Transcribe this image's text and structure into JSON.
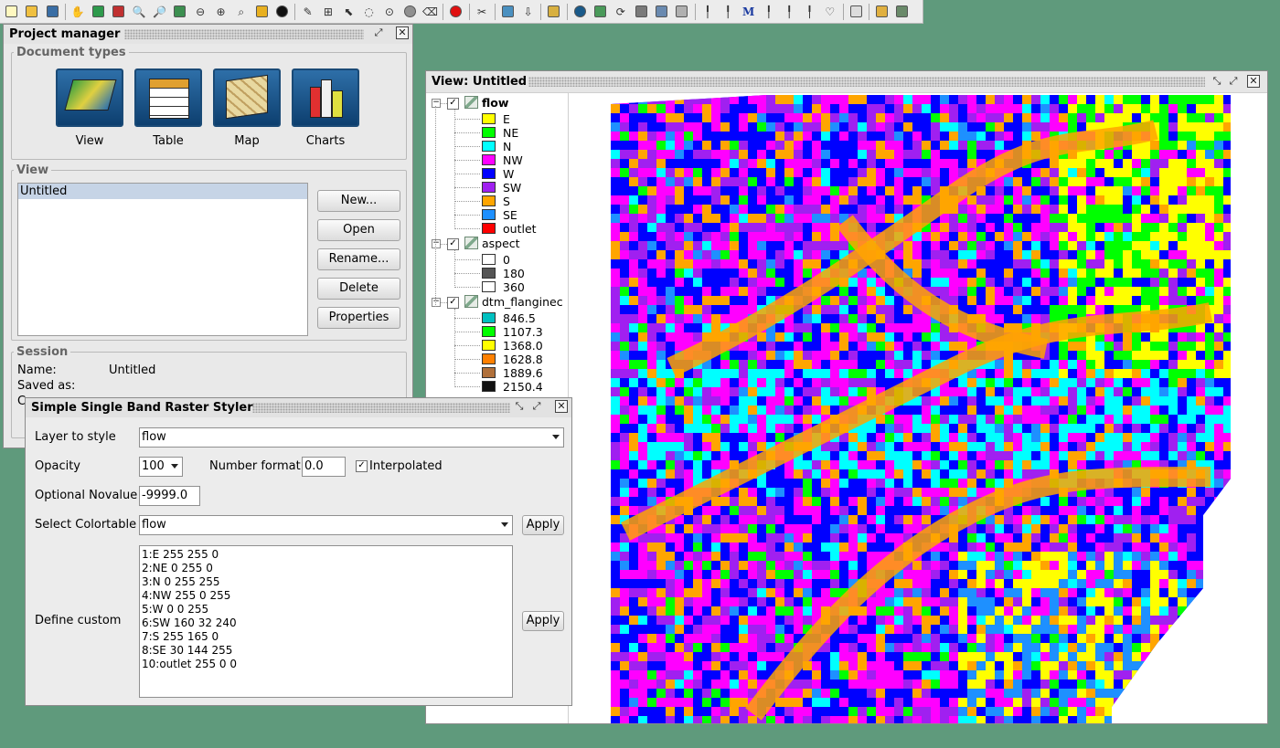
{
  "toolbar": {
    "icons": [
      "new-icon",
      "open-icon",
      "save-icon",
      "pan-icon",
      "zoom-extent-icon",
      "zoom-layer-icon",
      "zoom-in-icon",
      "zoom-out-icon",
      "layers-icon",
      "zoom-previous-icon",
      "zoom-next-icon",
      "zoom-select-icon",
      "select-color-icon",
      "info-icon",
      "measure-icon",
      "select-icon",
      "pointer-icon",
      "circle-select-icon",
      "lasso-icon",
      "sphere-icon",
      "erase-icon",
      "stop-icon",
      "tools-icon",
      "import-icon",
      "export-icon",
      "tape-icon",
      "globe-icon",
      "map-icon",
      "cycle-icon",
      "database-icon",
      "tools2-icon",
      "picture-icon",
      "pin-icon",
      "pin2-icon",
      "formula-icon",
      "pin3-icon",
      "pin4-icon",
      "pin5-icon",
      "balloon-icon",
      "notes-icon",
      "folder-icon",
      "gallery-icon"
    ]
  },
  "project_manager": {
    "title": "Project manager",
    "doc_types_title": "Document types",
    "doc_types": [
      {
        "label": "View"
      },
      {
        "label": "Table"
      },
      {
        "label": "Map"
      },
      {
        "label": "Charts"
      }
    ],
    "view_group_title": "View",
    "view_items": [
      "Untitled"
    ],
    "buttons": {
      "new": "New...",
      "open": "Open",
      "rename": "Rename...",
      "delete": "Delete",
      "properties": "Properties"
    },
    "session": {
      "title": "Session",
      "name_label": "Name:",
      "name_value": "Untitled",
      "saved_as_label": "Saved as:",
      "third_label": "C"
    }
  },
  "view_window": {
    "title": "View: Untitled",
    "layers": [
      {
        "name": "flow",
        "checked": true,
        "bold": true,
        "entries": [
          {
            "label": "E",
            "color": "#ffff00"
          },
          {
            "label": "NE",
            "color": "#00ff00"
          },
          {
            "label": "N",
            "color": "#00ffff"
          },
          {
            "label": "NW",
            "color": "#ff00ff"
          },
          {
            "label": "W",
            "color": "#0000ff"
          },
          {
            "label": "SW",
            "color": "#a020f0"
          },
          {
            "label": "S",
            "color": "#ffa500"
          },
          {
            "label": "SE",
            "color": "#1e90ff"
          },
          {
            "label": "outlet",
            "color": "#ff0000"
          }
        ]
      },
      {
        "name": "aspect",
        "checked": true,
        "bold": false,
        "entries": [
          {
            "label": "0",
            "color": "#ffffff"
          },
          {
            "label": "180",
            "color": "#555555"
          },
          {
            "label": "360",
            "color": "#ffffff"
          }
        ]
      },
      {
        "name": "dtm_flanginec",
        "checked": true,
        "bold": false,
        "entries": [
          {
            "label": "846.5",
            "color": "#00c0c0"
          },
          {
            "label": "1107.3",
            "color": "#00ff00"
          },
          {
            "label": "1368.0",
            "color": "#ffff00"
          },
          {
            "label": "1628.8",
            "color": "#ff8000"
          },
          {
            "label": "1889.6",
            "color": "#b0703a"
          },
          {
            "label": "2150.4",
            "color": "#111111"
          }
        ]
      }
    ]
  },
  "styler": {
    "title": "Simple Single Band Raster Styler",
    "layer_label": "Layer to style",
    "layer_value": "flow",
    "opacity_label": "Opacity",
    "opacity_value": "100",
    "number_format_label": "Number format",
    "number_format_value": "0.0",
    "interpolated_label": "Interpolated",
    "interpolated_checked": true,
    "novalue_label": "Optional Novalue",
    "novalue_value": "-9999.0",
    "colortable_label": "Select Colortable",
    "colortable_value": "flow",
    "apply_label": "Apply",
    "custom_label": "Define custom",
    "custom_lines": [
      "1:E 255 255 0",
      "2:NE 0 255 0",
      "3:N 0 255 255",
      "4:NW 255 0 255",
      "5:W 0 0 255",
      "6:SW 160 32 240",
      "7:S 255 165 0",
      "8:SE 30 144 255",
      "10:outlet 255 0 0"
    ]
  },
  "raster_palette": [
    "#ffff00",
    "#00ff00",
    "#00ffff",
    "#ff00ff",
    "#0000ff",
    "#a020f0",
    "#ffa500",
    "#1e90ff"
  ]
}
